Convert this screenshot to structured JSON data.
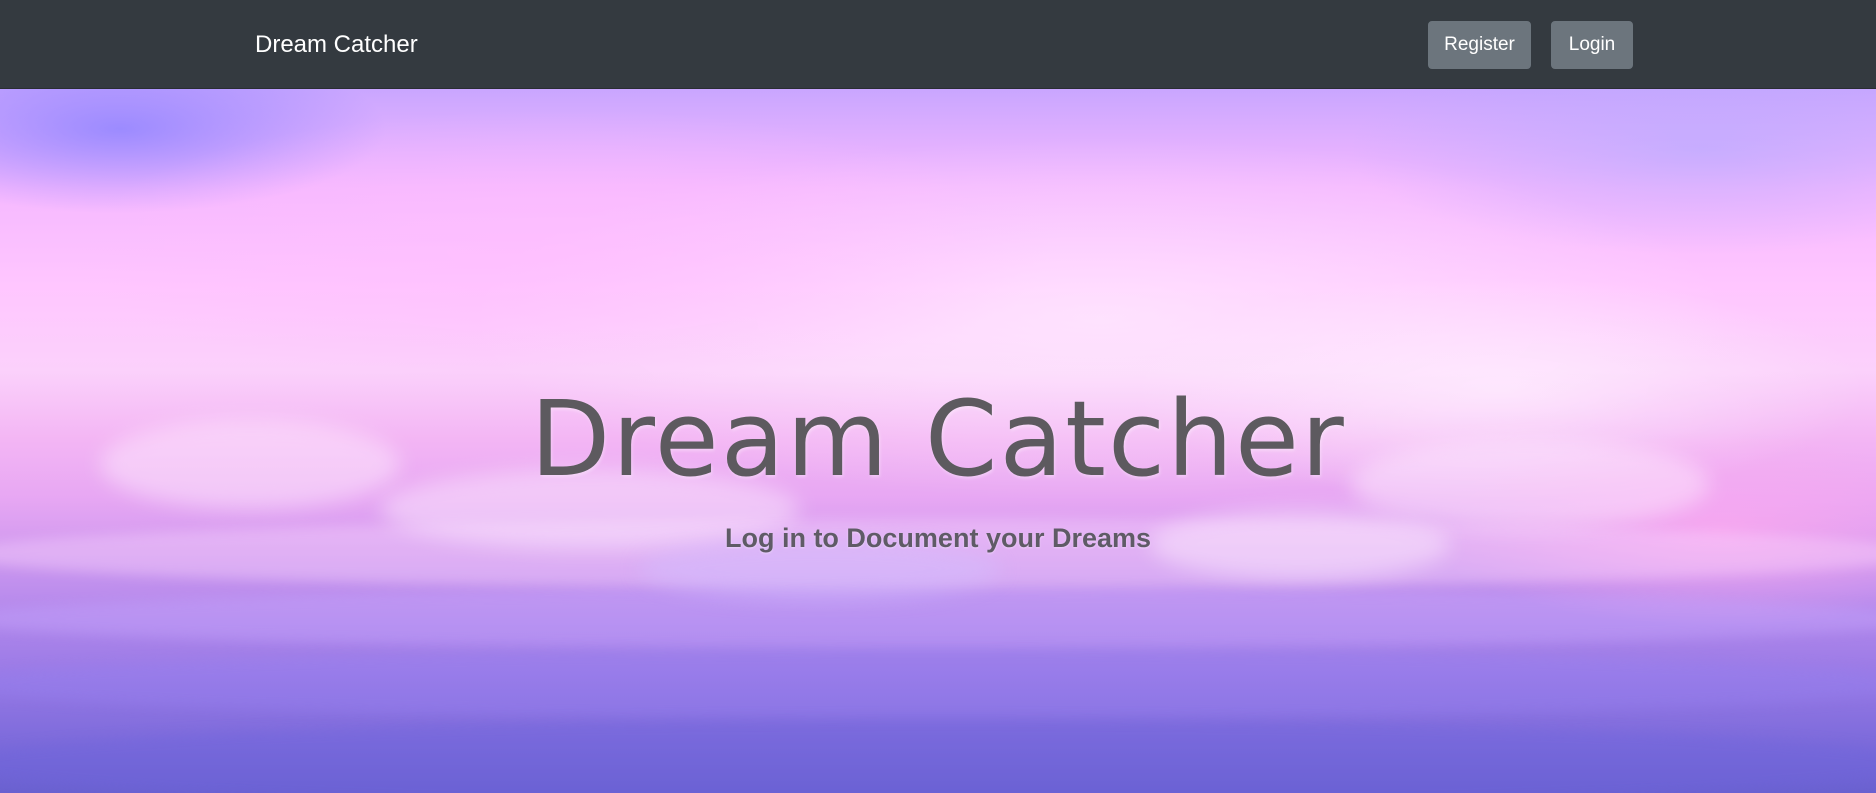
{
  "navbar": {
    "brand": "Dream Catcher",
    "register_label": "Register",
    "login_label": "Login",
    "background": "#343a40",
    "button_color": "#6c757d"
  },
  "hero": {
    "title": "Dream Catcher",
    "subtitle": "Log in to Document your Dreams",
    "background_image": "pastel-pink-purple-sky-above-clouds"
  }
}
